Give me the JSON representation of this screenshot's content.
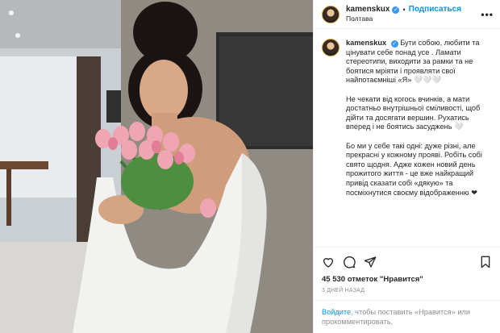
{
  "header": {
    "username": "kamenskux",
    "separator": "•",
    "follow_label": "Подписаться",
    "location": "Полтава",
    "more": "•••"
  },
  "caption": {
    "username": "kamenskux",
    "paragraphs": [
      "Бути собою, любити та цінувати себе понад усе . Ламати стереотипи, виходити за рамки та не боятися мріяти і проявляти свої найпотаємніші «Я» 🤍🤍🤍",
      "Не чекати від когось вчинків, а мати достатньо внутрішньої сміливості, щоб дійти та досягати вершин. Рухатись вперед і не боятись засуджень 🤍",
      "Бо ми у себе такі одні: дуже різні, але прекрасні у кожному прояві. Робіть собі свято щодня. Адже кожен новий день прожитого життя - це вже найкращий привід сказати собі «дякую» та посміхнутися своєму відображенню ❤"
    ]
  },
  "actions": {
    "icons": [
      "heart-icon",
      "comment-icon",
      "share-icon",
      "bookmark-icon"
    ],
    "likes": "45 530 отметок \"Нравится\"",
    "time": "3 ДНЕЙ НАЗАД"
  },
  "login_prompt": {
    "link": "Войдите",
    "text": ", чтобы поставить «Нравится» или прокомментировать."
  },
  "colors": {
    "link": "#0095f6",
    "verified": "#3897f0",
    "muted": "#8e8e8e"
  }
}
